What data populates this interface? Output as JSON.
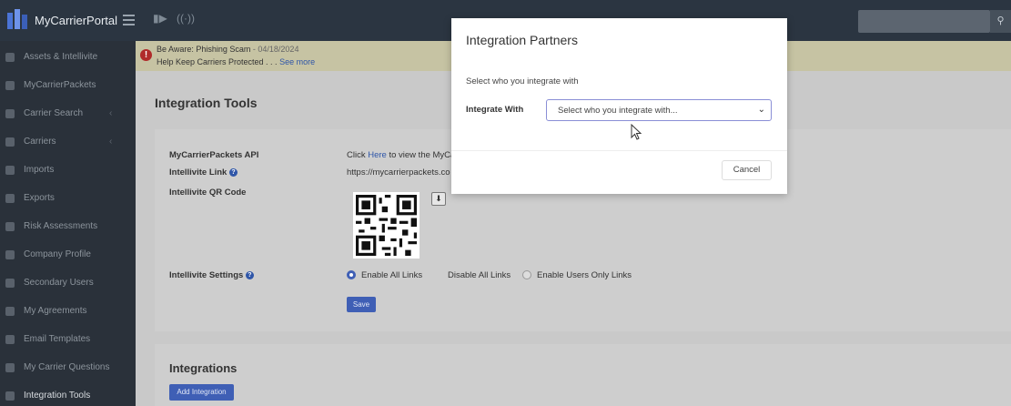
{
  "app": {
    "title": "MyCarrierPortal",
    "accent": "#3f5fb5",
    "topbar_color": "#2b3541",
    "sidebar_color": "#2a313a"
  },
  "topbar": {
    "icons": [
      "menu-icon",
      "megaphone-icon",
      "broadcast-icon",
      "search-icon"
    ]
  },
  "sidebar": {
    "items": [
      {
        "label": "Assets & Intellivite",
        "icon": "assets-icon"
      },
      {
        "label": "MyCarrierPackets",
        "icon": "packets-icon"
      },
      {
        "label": "Carrier Search",
        "icon": "search-icon",
        "caret": "‹"
      },
      {
        "label": "Carriers",
        "icon": "truck-icon",
        "caret": "‹"
      },
      {
        "label": "Imports",
        "icon": "import-icon"
      },
      {
        "label": "Exports",
        "icon": "export-icon"
      },
      {
        "label": "Risk Assessments",
        "icon": "risk-icon"
      },
      {
        "label": "Company Profile",
        "icon": "building-icon"
      },
      {
        "label": "Secondary Users",
        "icon": "user-icon"
      },
      {
        "label": "My Agreements",
        "icon": "document-icon"
      },
      {
        "label": "Email Templates",
        "icon": "mail-icon"
      },
      {
        "label": "My Carrier Questions",
        "icon": "question-icon"
      },
      {
        "label": "Integration Tools",
        "icon": "tools-icon",
        "active": true
      }
    ]
  },
  "alert": {
    "title": "Be Aware: Phishing Scam",
    "date": "- 04/18/2024",
    "message": "Help Keep Carriers Protected . . .",
    "link": "See more"
  },
  "page": {
    "title": "Integration Tools",
    "api_label": "MyCarrierPackets API",
    "api_text_prefix": "Click",
    "api_link": "Here",
    "api_text_suffix": "to view the MyCa",
    "link_label": "Intellivite Link",
    "link_value": "https://mycarrierpackets.co",
    "qr_label": "Intellivite QR Code",
    "settings_label": "Intellivite Settings",
    "radio_options": [
      {
        "label": "Enable All Links",
        "checked": true
      },
      {
        "label": "Disable All Links",
        "checked": false
      },
      {
        "label": "Enable Users Only Links",
        "checked": false
      }
    ],
    "save_label": "Save",
    "integrations_title": "Integrations",
    "add_integration_label": "Add Integration"
  },
  "modal": {
    "title": "Integration Partners",
    "subtitle": "Select who you integrate with",
    "field_label": "Integrate With",
    "select_value": "Select who you integrate with...",
    "cancel_label": "Cancel"
  }
}
